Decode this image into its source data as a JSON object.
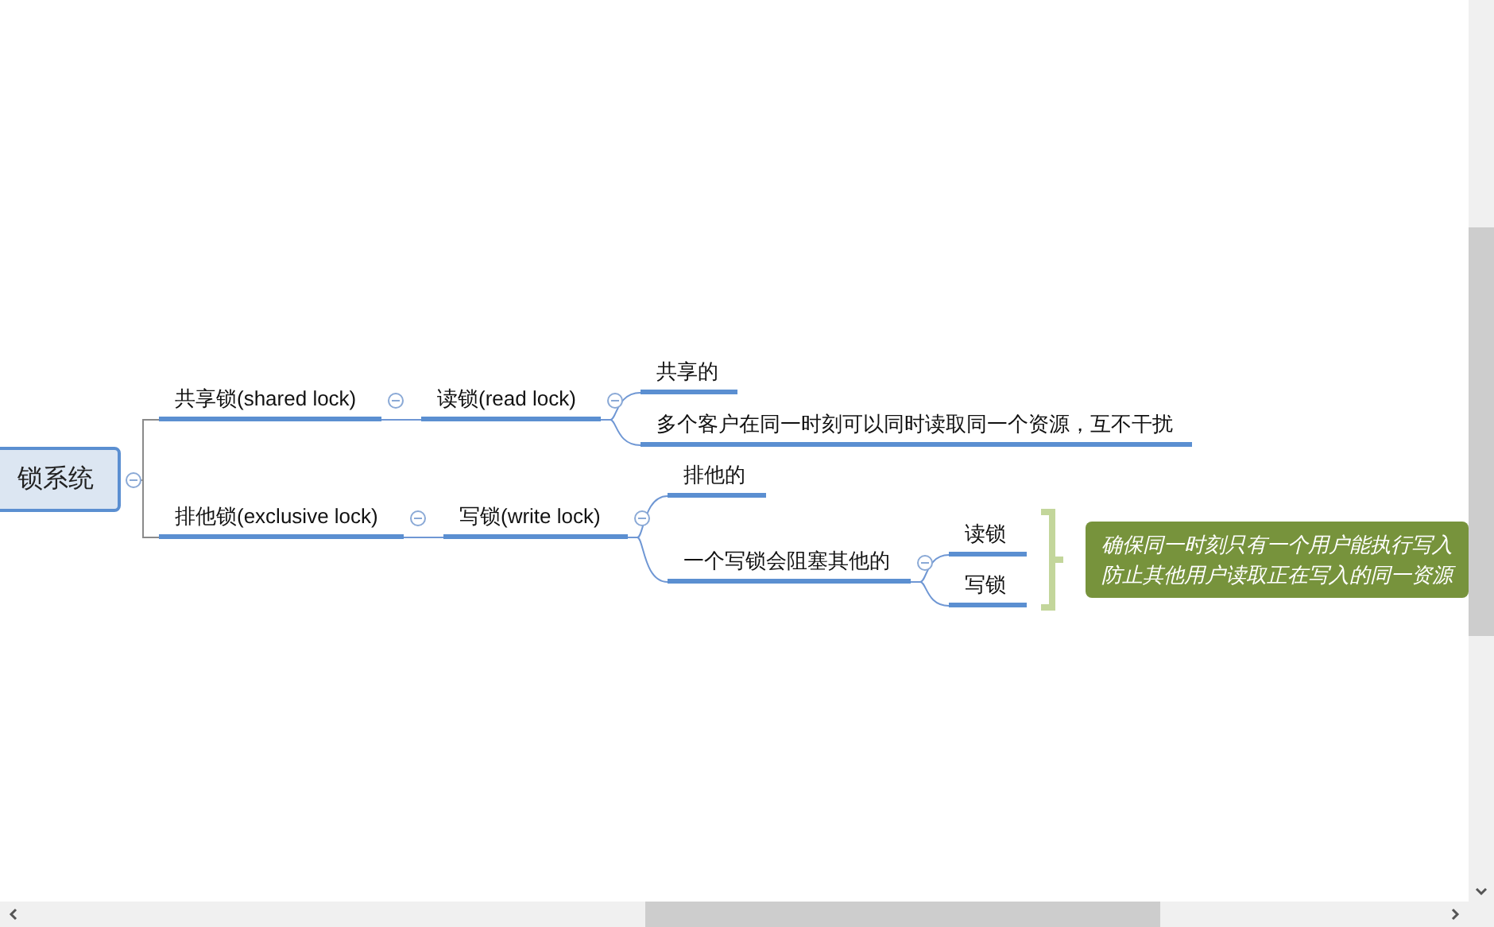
{
  "mind_map": {
    "root": {
      "label": "锁系统",
      "expanded": true,
      "children": [
        {
          "label": "共享锁(shared lock)",
          "expanded": true,
          "children": [
            {
              "label": "读锁(read lock)",
              "expanded": true,
              "children": [
                {
                  "label": "共享的"
                },
                {
                  "label": "多个客户在同一时刻可以同时读取同一个资源，互不干扰"
                }
              ]
            }
          ]
        },
        {
          "label": "排他锁(exclusive lock)",
          "expanded": true,
          "children": [
            {
              "label": "写锁(write lock)",
              "expanded": true,
              "children": [
                {
                  "label": "排他的"
                },
                {
                  "label": "一个写锁会阻塞其他的",
                  "expanded": true,
                  "summary": {
                    "lines": [
                      "确保同一时刻只有一个用户能执行写入",
                      "防止其他用户读取正在写入的同一资源"
                    ]
                  },
                  "children": [
                    {
                      "label": "读锁"
                    },
                    {
                      "label": "写锁"
                    }
                  ]
                }
              ]
            }
          ]
        }
      ]
    }
  }
}
